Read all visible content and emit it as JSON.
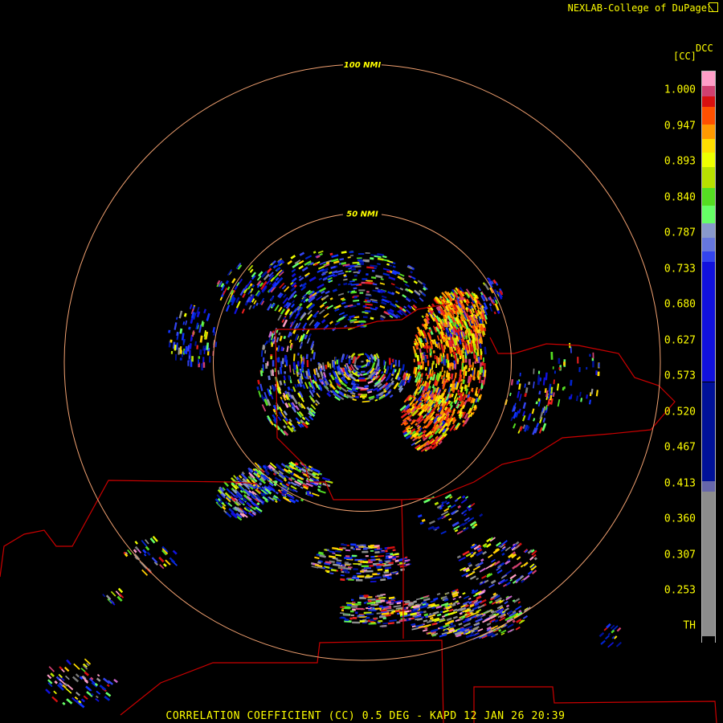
{
  "header": {
    "credit": "NEXLAB-College of DuPage",
    "credit_logo_icon": "nexlab-logo-icon"
  },
  "legend": {
    "product": "DCC",
    "unit": "[CC]",
    "labels": [
      "1.000",
      "0.947",
      "0.893",
      "0.840",
      "0.787",
      "0.733",
      "0.680",
      "0.627",
      "0.573",
      "0.520",
      "0.467",
      "0.413",
      "0.360",
      "0.307",
      "0.253",
      "TH"
    ],
    "bands": [
      {
        "from": 1.0,
        "to": 0.98,
        "color": "#ff9ec8"
      },
      {
        "from": 0.98,
        "to": 0.965,
        "color": "#d04070"
      },
      {
        "from": 0.965,
        "to": 0.95,
        "color": "#d81010"
      },
      {
        "from": 0.95,
        "to": 0.925,
        "color": "#ff5000"
      },
      {
        "from": 0.925,
        "to": 0.905,
        "color": "#ff9900"
      },
      {
        "from": 0.905,
        "to": 0.885,
        "color": "#ffdd00"
      },
      {
        "from": 0.885,
        "to": 0.865,
        "color": "#eeff00"
      },
      {
        "from": 0.865,
        "to": 0.835,
        "color": "#b8e000"
      },
      {
        "from": 0.835,
        "to": 0.81,
        "color": "#55dd22"
      },
      {
        "from": 0.81,
        "to": 0.785,
        "color": "#66ff66"
      },
      {
        "from": 0.785,
        "to": 0.765,
        "color": "#8899cc"
      },
      {
        "from": 0.765,
        "to": 0.745,
        "color": "#6677dd"
      },
      {
        "from": 0.745,
        "to": 0.73,
        "color": "#3344ee"
      },
      {
        "from": 0.73,
        "to": 0.56,
        "color": "#1111dd"
      },
      {
        "from": 0.56,
        "to": 0.42,
        "color": "#001199"
      },
      {
        "from": 0.42,
        "to": 0.405,
        "color": "#6666aa"
      },
      {
        "from": 0.405,
        "to": 0.2,
        "color": "#8c8c8c"
      },
      {
        "from": 0.2,
        "to": 0.19,
        "color": "#000000"
      }
    ]
  },
  "map": {
    "range_rings": [
      {
        "label": "100 NMI",
        "radius_nmi": 100
      },
      {
        "label": "50 NMI",
        "radius_nmi": 50
      }
    ],
    "colors": {
      "range_ring": "#f0a070",
      "border": "#cc0000",
      "label": "#ffff00"
    }
  },
  "footer": {
    "title": "CORRELATION COEFFICIENT (CC) 0.5 DEG - KAPD 12 JAN 26 20:39"
  }
}
